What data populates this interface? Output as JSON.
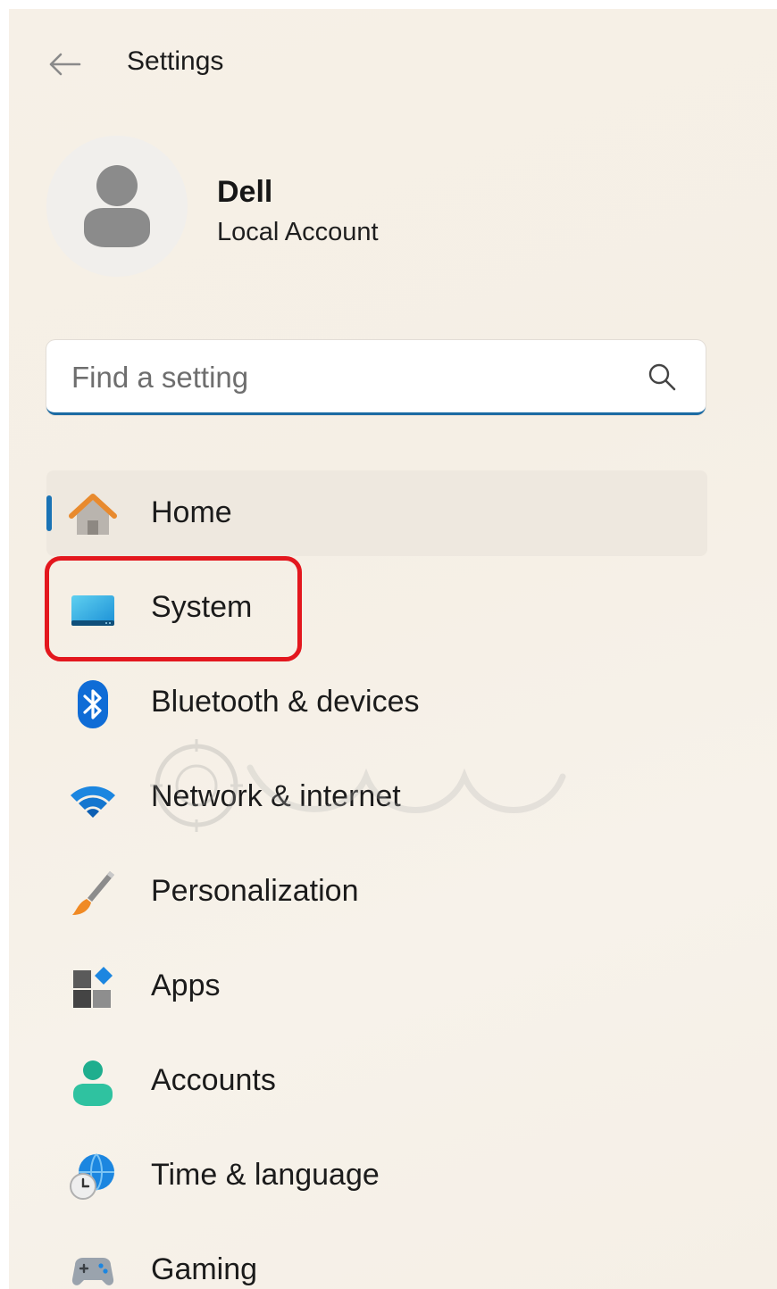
{
  "window": {
    "title": "Settings"
  },
  "profile": {
    "name": "Dell",
    "account_type": "Local Account"
  },
  "search": {
    "placeholder": "Find a setting",
    "value": ""
  },
  "nav": {
    "selected": "Home",
    "items": [
      {
        "label": "Home",
        "icon": "home-icon"
      },
      {
        "label": "System",
        "icon": "system-display-icon"
      },
      {
        "label": "Bluetooth & devices",
        "icon": "bluetooth-icon"
      },
      {
        "label": "Network & internet",
        "icon": "wifi-icon"
      },
      {
        "label": "Personalization",
        "icon": "paintbrush-icon"
      },
      {
        "label": "Apps",
        "icon": "apps-icon"
      },
      {
        "label": "Accounts",
        "icon": "person-icon"
      },
      {
        "label": "Time & language",
        "icon": "globe-clock-icon"
      },
      {
        "label": "Gaming",
        "icon": "gamepad-icon"
      }
    ]
  },
  "colors": {
    "accent": "#1a73b5",
    "highlight_box": "#e3171e",
    "background": "#f6f0e7"
  }
}
